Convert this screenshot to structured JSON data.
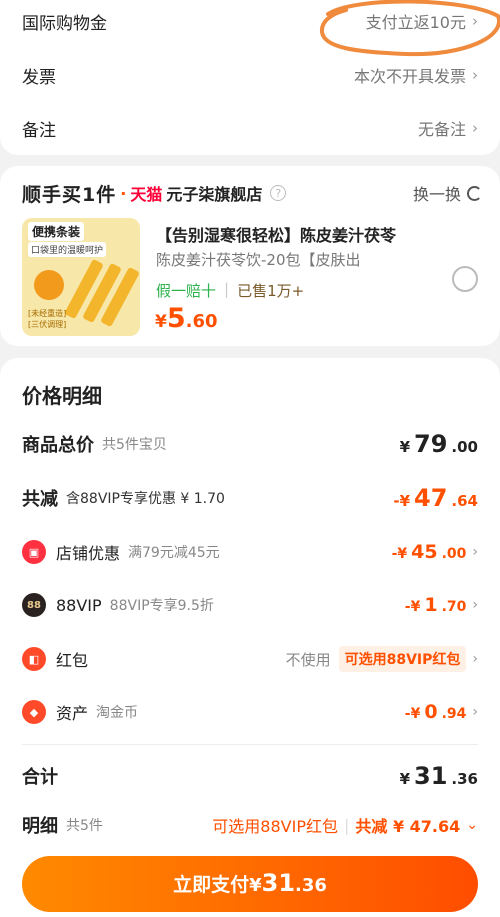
{
  "top_rows": [
    {
      "label": "国际购物金",
      "value": "支付立返10元"
    },
    {
      "label": "发票",
      "value": "本次不开具发票"
    },
    {
      "label": "备注",
      "value": "无备注"
    }
  ],
  "shop": {
    "promo": "顺手买1件",
    "tmall": "天猫",
    "name": "元子柒旗舰店",
    "swap": "换一换"
  },
  "product": {
    "img_tag1": "便携条装",
    "img_tag2": "口袋里的温暖呵护",
    "img_text": "[未经重造]\n[三伏调理]",
    "title": "【告别湿寒很轻松】陈皮姜汁茯苓",
    "spec": "陈皮姜汁茯苓饮-20包【皮肤出",
    "tag_fake": "假一赔十",
    "tag_sold": "已售1万+",
    "price_cur": "¥",
    "price_int": "5",
    "price_dec": ".60"
  },
  "price_detail": {
    "title": "价格明细",
    "total": {
      "label": "商品总价",
      "sub": "共5件宝贝",
      "cur": "¥",
      "int": "79",
      "dec": ".00"
    },
    "reduce": {
      "label": "共减",
      "sub": "含88VIP专享优惠 ¥ 1.70",
      "cur": "-¥",
      "int": "47",
      "dec": ".64"
    },
    "shop_disc": {
      "label": "店铺优惠",
      "sub": "满79元减45元",
      "cur": "-¥",
      "int": "45",
      "dec": ".00"
    },
    "vip": {
      "badge": "88",
      "label": "88VIP",
      "sub": "88VIP专享9.5折",
      "cur": "-¥",
      "int": "1",
      "dec": ".70"
    },
    "redpack": {
      "label": "红包",
      "nouse": "不使用",
      "btn": "可选用88VIP红包"
    },
    "asset": {
      "label": "资产",
      "sub": "淘金币",
      "cur": "-¥",
      "int": "0",
      "dec": ".94"
    },
    "sum": {
      "label": "合计",
      "cur": "¥",
      "int": "31",
      "dec": ".36"
    },
    "detail": {
      "label": "明细",
      "sub": "共5件",
      "vip_hint": "可选用88VIP红包",
      "reduce_text": "共减 ¥ 47.64"
    }
  },
  "pay": {
    "label": "立即支付",
    "cur": "¥",
    "int": "31",
    "dec": ".36"
  },
  "colors": {
    "accent": "#ff5000",
    "tmall": "#ff0036",
    "green": "#2bb24c"
  }
}
